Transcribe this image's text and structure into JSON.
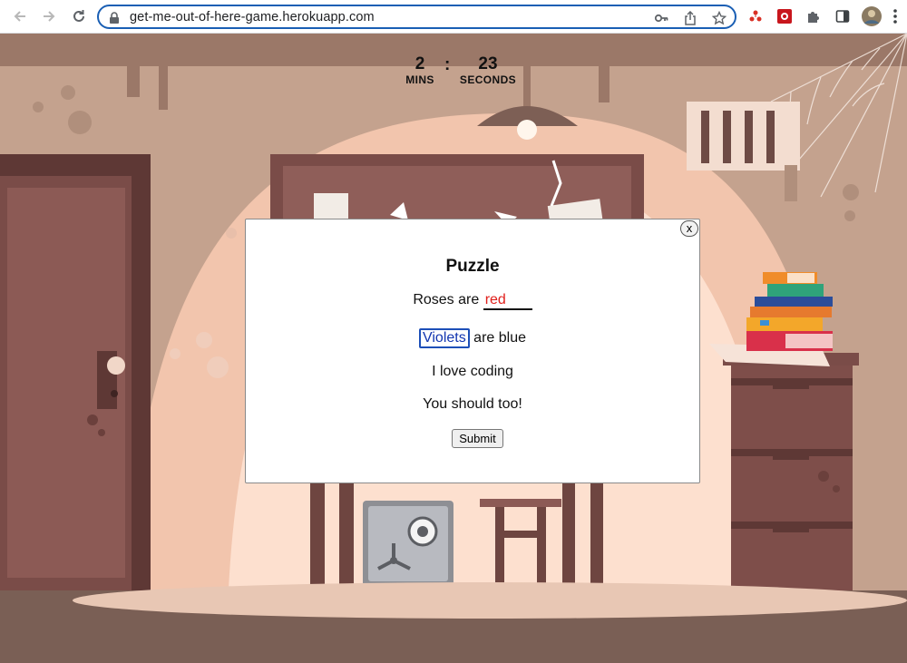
{
  "browser": {
    "url": "get-me-out-of-here-game.herokuapp.com",
    "accent_color": "#1a5fb4",
    "icons": [
      "back-icon",
      "forward-icon",
      "reload-icon",
      "lock-icon",
      "key-icon",
      "share-icon",
      "star-icon",
      "extension-red-icon",
      "extension-game-icon",
      "puzzle-extensions-icon",
      "side-panel-icon",
      "profile-avatar",
      "menu-icon"
    ]
  },
  "timer": {
    "minutes": "2",
    "minutes_label": "MINS",
    "separator": ":",
    "seconds": "23",
    "seconds_label": "SECONDS"
  },
  "puzzle": {
    "close_label": "x",
    "title": "Puzzle",
    "line1_prefix": "Roses are",
    "line1_answer": "red",
    "line2_word": "Violets",
    "line2_rest": "are blue",
    "line3": "I love coding",
    "line4": "You should too!",
    "submit_label": "Submit",
    "answer_color": "#e0201c",
    "highlight_color": "#1d4fb8"
  }
}
